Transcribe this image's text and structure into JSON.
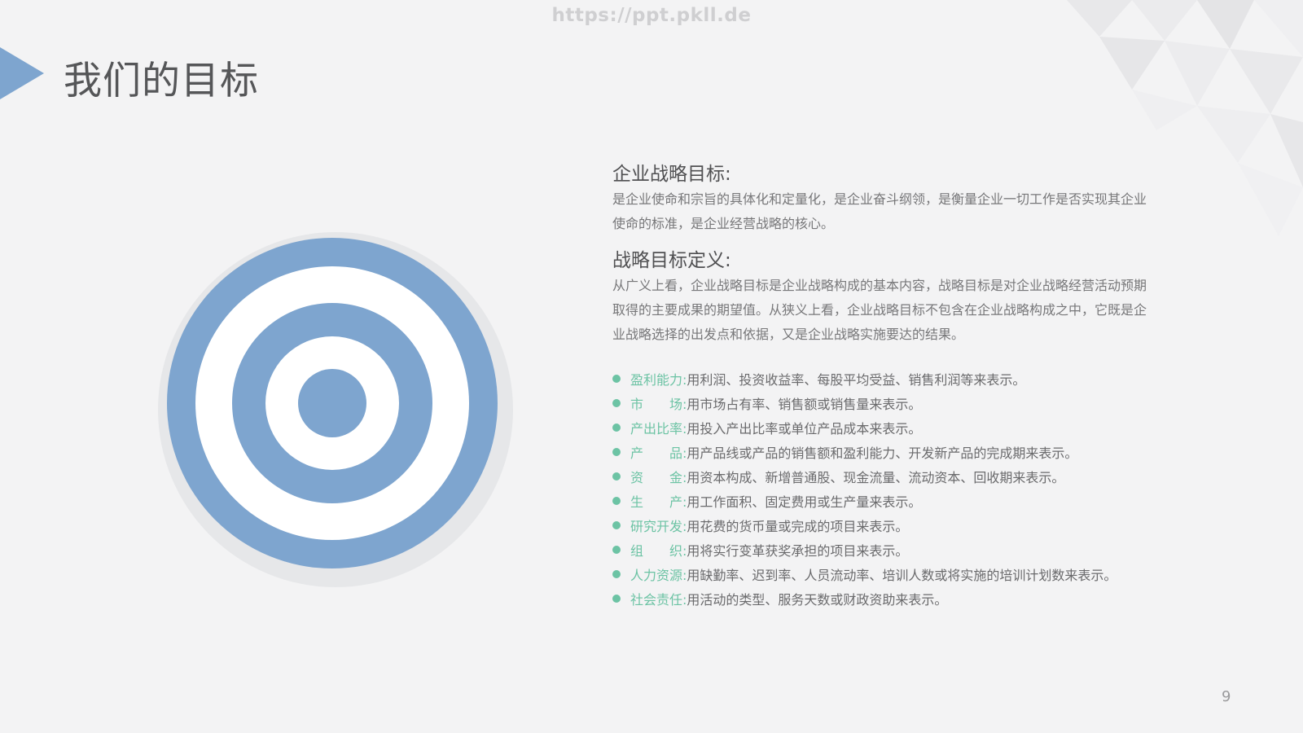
{
  "watermark": "https://ppt.pkll.de",
  "header": {
    "title": "我们的目标"
  },
  "colors": {
    "accent_blue": "#7ea5cf",
    "accent_green": "#6cc3a4",
    "background": "#f3f3f4"
  },
  "sections": [
    {
      "heading": "企业战略目标:",
      "body": "是企业使命和宗旨的具体化和定量化，是企业奋斗纲领，是衡量企业一切工作是否实现其企业使命的标准，是企业经营战略的核心。"
    },
    {
      "heading": "战略目标定义:",
      "body": "从广义上看，企业战略目标是企业战略构成的基本内容，战略目标是对企业战略经营活动预期取得的主要成果的期望值。从狭义上看，企业战略目标不包含在企业战略构成之中，它既是企业战略选择的出发点和依据，又是企业战略实施要达的结果。"
    }
  ],
  "bullets": [
    {
      "term": "盈利能力:",
      "desc": "用利润、投资收益率、每股平均受益、销售利润等来表示。"
    },
    {
      "term": "市　　场:",
      "desc": "用市场占有率、销售额或销售量来表示。"
    },
    {
      "term": "产出比率:",
      "desc": "用投入产出比率或单位产品成本来表示。"
    },
    {
      "term": "产　　品:",
      "desc": "用产品线或产品的销售额和盈利能力、开发新产品的完成期来表示。"
    },
    {
      "term": "资　　金:",
      "desc": "用资本构成、新增普通股、现金流量、流动资本、回收期来表示。"
    },
    {
      "term": "生　　产:",
      "desc": "用工作面积、固定费用或生产量来表示。"
    },
    {
      "term": "研究开发:",
      "desc": "用花费的货币量或完成的项目来表示。"
    },
    {
      "term": "组　　织:",
      "desc": "用将实行变革获奖承担的项目来表示。"
    },
    {
      "term": "人力资源:",
      "desc": "用缺勤率、迟到率、人员流动率、培训人数或将实施的培训计划数来表示。"
    },
    {
      "term": "社会责任:",
      "desc": "用活动的类型、服务天数或财政资助来表示。"
    }
  ],
  "page_number": "9"
}
